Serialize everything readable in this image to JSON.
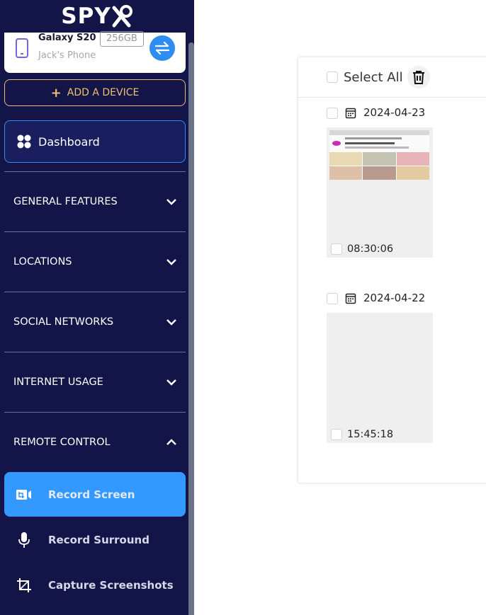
{
  "brand": {
    "logo_text": "SPY",
    "accent": "#2f8cf0",
    "sidebar_bg": "#131448",
    "add_device_color": "#f1c06e"
  },
  "device": {
    "name": "Galaxy S20",
    "storage": "256GB",
    "owner": "Jack's Phone"
  },
  "sidebar": {
    "add_device_label": "ADD A DEVICE",
    "dashboard_label": "Dashboard",
    "sections": [
      {
        "label": "GENERAL FEATURES",
        "expanded": false
      },
      {
        "label": "LOCATIONS",
        "expanded": false
      },
      {
        "label": "SOCIAL NETWORKS",
        "expanded": false
      },
      {
        "label": "INTERNET USAGE",
        "expanded": false
      },
      {
        "label": "REMOTE CONTROL",
        "expanded": true
      }
    ],
    "remote_items": [
      {
        "label": "Record Screen",
        "icon": "screen-record-icon",
        "active": true
      },
      {
        "label": "Record Surround",
        "icon": "microphone-icon",
        "active": false
      },
      {
        "label": "Capture Screenshots",
        "icon": "crop-icon",
        "active": false
      }
    ]
  },
  "main": {
    "select_all_label": "Select All",
    "groups": [
      {
        "date": "2024-04-23",
        "items": [
          {
            "time": "08:30:06",
            "has_preview": true
          }
        ]
      },
      {
        "date": "2024-04-22",
        "items": [
          {
            "time": "15:45:18",
            "has_preview": false
          }
        ]
      }
    ]
  }
}
